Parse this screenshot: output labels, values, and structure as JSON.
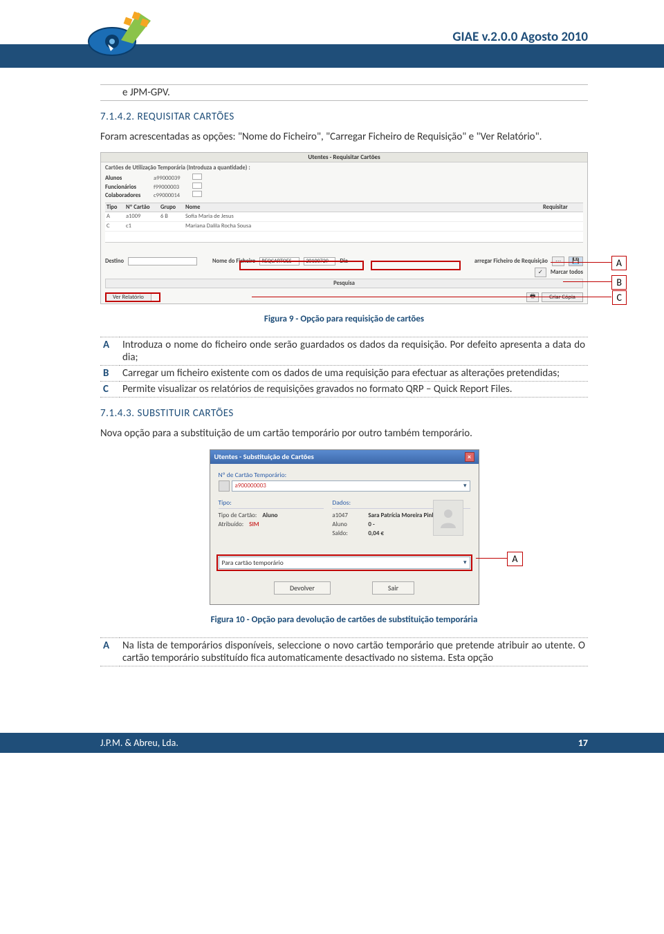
{
  "header": {
    "title": "GIAE v.2.0.0 Agosto 2010"
  },
  "topline": {
    "text": "e JPM-GPV."
  },
  "sec1": {
    "num_title": "7.1.4.2. REQUISITAR CARTÕES",
    "intro": "Foram acrescentadas as opções: \"Nome do Ficheiro\", \"Carregar Ficheiro de Requisição\" e \"Ver Relatório\"."
  },
  "fig1": {
    "panel_title": "Utentes - Requisitar Cartões",
    "subtitle": "Cartões de Utilização Temporária (Introduza a quantidade) :",
    "rows_left": [
      {
        "k": "Alunos",
        "v": "a99000039"
      },
      {
        "k": "Funcionários",
        "v": "f99000003"
      },
      {
        "k": "Colaboradores",
        "v": "c99000014"
      }
    ],
    "th": [
      "Tipo",
      "Nº Cartão",
      "Grupo",
      "Nome",
      "Requisitar"
    ],
    "tr": [
      [
        "A",
        "a1009",
        "6 B",
        "Sofia Maria de Jesus",
        ""
      ],
      [
        "C",
        "c1",
        "",
        "Mariana Dalila Rocha Sousa",
        ""
      ]
    ],
    "destino_lbl": "Destino",
    "nome_lbl": "Nome do Ficheiro",
    "nome_val": "REQCARTOES",
    "data_val": "20100729",
    "dia_lbl": "Dia",
    "carregar_lbl": "arregar Ficheiro de Requisição",
    "marcar_lbl": "Marcar todos",
    "pesquisa_lbl": "Pesquisa",
    "ver_lbl": "Ver Relatório",
    "criar_lbl": "Criar Cópia",
    "co": {
      "a": "A",
      "b": "B",
      "c": "C"
    },
    "caption": "Figura 9 - Opção para requisição de cartões"
  },
  "tbl1": {
    "rows": [
      {
        "k": "A",
        "v": "Introduza o nome do ficheiro onde serão guardados os dados da requisição. Por defeito apresenta a data do dia;"
      },
      {
        "k": "B",
        "v": "Carregar um ficheiro existente com os dados de uma requisição para efectuar as alterações pretendidas;"
      },
      {
        "k": "C",
        "v": "Permite visualizar os relatórios de requisições gravados no formato QRP – Quick Report Files."
      }
    ]
  },
  "sec2": {
    "num_title": "7.1.4.3. SUBSTITUIR CARTÕES",
    "intro": "Nova opção para a substituição de um cartão temporário por outro também temporário."
  },
  "fig2": {
    "title": "Utentes - Substituição de Cartões",
    "lbl_num": "Nº de Cartão Temporário:",
    "num_val": "a900000003",
    "col1_hd": "Tipo:",
    "col1": [
      {
        "k": "Tipo de Cartão:",
        "v": "Aluno"
      },
      {
        "k": "Atribuído:",
        "v": "SIM",
        "vcolor": "#c33"
      }
    ],
    "col2_hd": "Dados:",
    "col2": [
      {
        "k": "a1047",
        "v": "Sara Patrícia Moreira Pinhal"
      },
      {
        "k": "Aluno",
        "v": "0 -"
      },
      {
        "k": "Saldo:",
        "v": "0,04 €"
      }
    ],
    "drop_lbl": "Para cartão temporário",
    "btn1": "Devolver",
    "btn2": "Sair",
    "co_a": "A",
    "caption": "Figura 10 - Opção para devolução de cartões de substituição temporária"
  },
  "tbl2": {
    "rows": [
      {
        "k": "A",
        "v": "Na lista de temporários disponíveis, seleccione o novo cartão temporário que pretende atribuir ao utente. O cartão temporário substituído fica automaticamente desactivado no sistema. Esta opção"
      }
    ]
  },
  "footer": {
    "left": "J.P.M. & Abreu, Lda.",
    "page": "17"
  }
}
